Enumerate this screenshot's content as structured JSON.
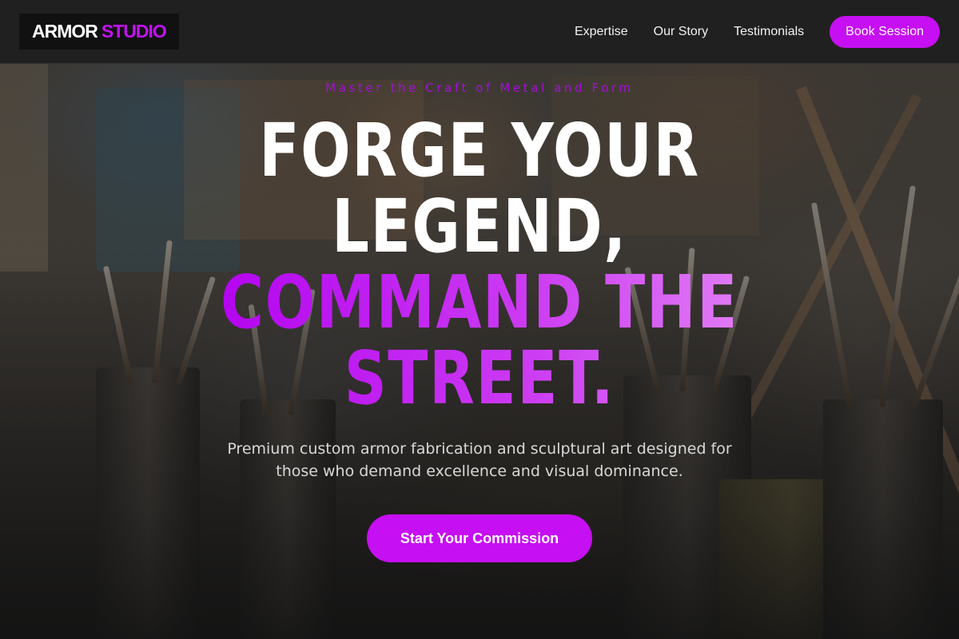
{
  "brand": {
    "word_1": "ARMOR",
    "word_2": "STUDIO",
    "accent_color": "#c60ff2"
  },
  "nav": {
    "links": [
      {
        "label": "Expertise"
      },
      {
        "label": "Our Story"
      },
      {
        "label": "Testimonials"
      }
    ],
    "cta_label": "Book Session"
  },
  "hero": {
    "eyebrow": "Master the Craft of Metal and Form",
    "headline_lines": [
      {
        "text": "FORGE YOUR",
        "style": "white"
      },
      {
        "text": "LEGEND,",
        "style": "white"
      },
      {
        "text": "COMMAND THE",
        "style": "accent"
      },
      {
        "text": "STREET.",
        "style": "accent"
      }
    ],
    "subtitle": "Premium custom armor fabrication and sculptural art designed for those who demand excellence and visual dominance.",
    "cta_label": "Start Your Commission",
    "background": "art studio with paint brushes and jars"
  }
}
